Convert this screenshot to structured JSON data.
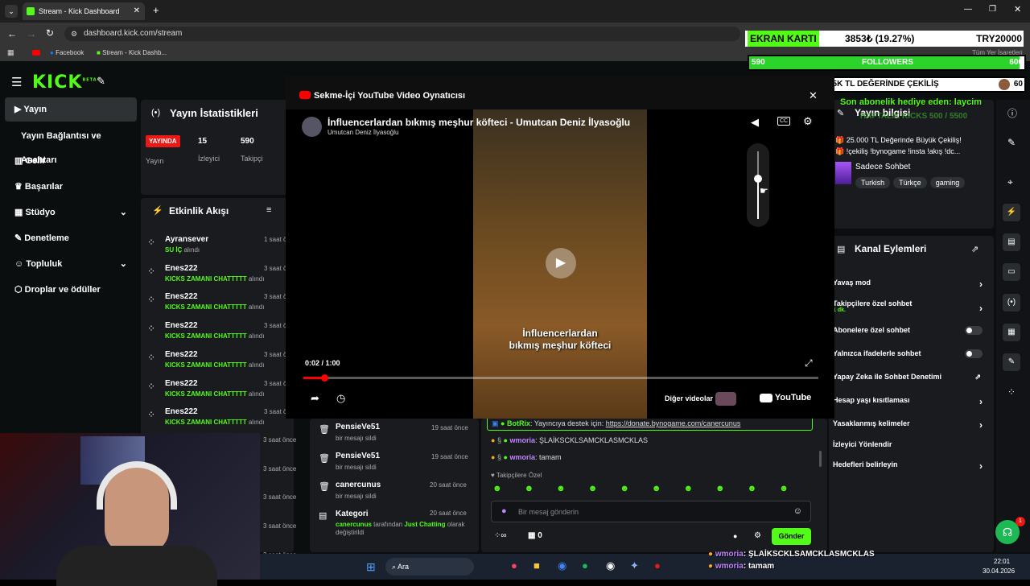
{
  "browser": {
    "tab_title": "Stream - Kick Dashboard",
    "url": "dashboard.kick.com/stream",
    "bookmarks": [
      "Facebook",
      "Stream - Kick Dashb..."
    ],
    "all_bookmarks": "Tüm Yer İşaretleri"
  },
  "sidebar": {
    "logo": "KICK",
    "beta": "BETA",
    "items": [
      {
        "label": "Yayın",
        "active": true
      },
      {
        "label": "Yayın Bağlantısı ve Anahtarı"
      },
      {
        "label": "Gelir"
      },
      {
        "label": "Başarılar"
      },
      {
        "label": "Stüdyo"
      },
      {
        "label": "Denetleme"
      },
      {
        "label": "Topluluk"
      },
      {
        "label": "Droplar ve ödüller"
      }
    ]
  },
  "stats": {
    "title": "Yayın İstatistikleri",
    "live_badge": "YAYINDA",
    "live_label": "Yayın",
    "viewers_value": "15",
    "viewers_label": "İzleyici",
    "followers_value": "590",
    "followers_label": "Takipçi"
  },
  "activity": {
    "title": "Etkinlik Akışı",
    "items": [
      {
        "user": "Ayransever",
        "reward": "SU İÇ",
        "suffix": "alındı",
        "time": "1 saat ö"
      },
      {
        "user": "Enes222",
        "reward": "KICKS ZAMANI CHATTTTT",
        "suffix": "alındı",
        "time": "3 saat ö"
      },
      {
        "user": "Enes222",
        "reward": "KICKS ZAMANI CHATTTTT",
        "suffix": "alındı",
        "time": "3 saat ö"
      },
      {
        "user": "Enes222",
        "reward": "KICKS ZAMANI CHATTTTT",
        "suffix": "alındı",
        "time": "3 saat ö"
      },
      {
        "user": "Enes222",
        "reward": "KICKS ZAMANI CHATTTTT",
        "suffix": "alındı",
        "time": "3 saat ö"
      },
      {
        "user": "Enes222",
        "reward": "KICKS ZAMANI CHATTTTT",
        "suffix": "alındı",
        "time": "3 saat ö"
      },
      {
        "user": "Enes222",
        "reward": "KICKS ZAMANI CHATTTTT",
        "suffix": "alındı",
        "time": "3 saat ö"
      }
    ],
    "extra_times": [
      "3 saat önce",
      "3 saat önce",
      "3 saat önce",
      "3 saat önce",
      "3 saat önce"
    ]
  },
  "modlog": {
    "items": [
      {
        "user": "PensieVe51",
        "action": "bir mesajı sildi",
        "time": "19 saat önce"
      },
      {
        "user": "PensieVe51",
        "action": "bir mesajı sildi",
        "time": "19 saat önce"
      },
      {
        "user": "canercunus",
        "action": "bir mesajı sildi",
        "time": "20 saat önce"
      }
    ],
    "category_title": "Kategori",
    "category_user": "canercunus",
    "category_mid": "tarafından",
    "category_value": "Just Chatting",
    "category_suffix": "olarak değiştirildi",
    "category_time": "20 saat önce"
  },
  "player": {
    "modal_title": "Sekme-İçi YouTube Video Oynatıcısı",
    "video_title": "İnfluencerlardan bıkmış meşhur köfteci - Umutcan Deniz İlyasoğlu",
    "channel": "Umutcan Deniz İlyasoğlu",
    "subtitle_line1": "İnfluencerlardan",
    "subtitle_line2": "bıkmış meşhur köfteci",
    "time": "0:02 / 1:00",
    "more_videos": "Diğer videolar",
    "youtube": "YouTube",
    "cc": "CC",
    "progress": 0.04,
    "volume": 0.6
  },
  "chat": {
    "messages": [
      {
        "user": "BotRix",
        "text": "Yayıncıya destek için:",
        "link": "https://donate.bynogame.com/canercunus"
      },
      {
        "user": "wmoria",
        "text": "ŞLAİKSCKLSAMCKLASMCKLAS"
      },
      {
        "user": "wmoria",
        "text": "tamam"
      }
    ],
    "followers_only": "Takipçilere Özel",
    "input_placeholder": "Bir mesaj gönderin",
    "points": "0",
    "send": "Gönder"
  },
  "stream_info": {
    "title": "Yayın bilgisi",
    "line1": "25.000 TL Değerinde Büyük Çekiliş!",
    "line2": "!çekiliş !bynogame !insta !akış !dc...",
    "category": "Sadece Sohbet",
    "tags": [
      "Turkish",
      "Türkçe",
      "gaming"
    ]
  },
  "channel_actions": {
    "title": "Kanal Eylemleri",
    "items": [
      {
        "label": "Yavaş mod",
        "type": "chevron"
      },
      {
        "label": "Takipçilere özel sohbet",
        "sub": "1 dk.",
        "type": "chevron"
      },
      {
        "label": "Abonelere özel sohbet",
        "type": "toggle"
      },
      {
        "label": "Yalnızca ifadelerle sohbet",
        "type": "toggle"
      },
      {
        "label": "Yapay Zeka ile Sohbet Denetimi",
        "type": "external"
      },
      {
        "label": "Hesap yaşı kısıtlaması",
        "type": "chevron"
      },
      {
        "label": "Yasaklanmış kelimeler",
        "type": "chevron"
      },
      {
        "label": "İzleyici Yönlendir",
        "type": "none"
      },
      {
        "label": "Hedefleri belirleyin",
        "type": "chevron"
      }
    ]
  },
  "overlay": {
    "ticker_label": "EKRAN KARTI",
    "ticker_value": "3853₺ (19.27%)",
    "ticker_target": "TRY20000",
    "followers_left": "590",
    "followers_label": "FOLLOWERS",
    "followers_right": "600",
    "giveaway_left": "0",
    "giveaway_label": "25K TL DEĞERİNDE ÇEKİLİŞ",
    "giveaway_right": "60",
    "followers_fill": 0.983,
    "sub_gift": "Son abonelik hediye eden: laycim",
    "sub_gift_sub": "HAFTALIK KICKS 500 / 5500",
    "bottom_chat": [
      {
        "user": "wmoria",
        "text": "ŞLAİKSCKLSAMCKLASMCKLAS"
      },
      {
        "user": "wmoria",
        "text": "tamam"
      }
    ]
  },
  "taskbar": {
    "search": "Ara",
    "time": "22:01",
    "date": "30.04.2026"
  },
  "notification_count": "1",
  "colors": {
    "kick_green": "#53fc18",
    "bg": "#0b0e0f",
    "panel": "#191b1f",
    "youtube_red": "#ff0000",
    "live_red": "#e91916"
  }
}
